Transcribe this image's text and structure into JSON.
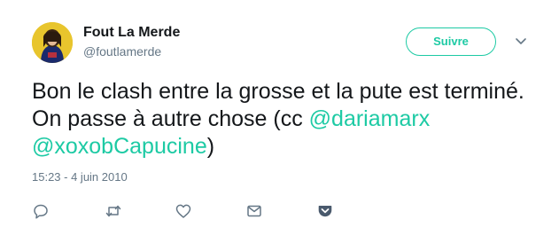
{
  "author": {
    "name": "Fout La Merde",
    "handle": "@foutlamerde"
  },
  "follow_label": "Suivre",
  "tweet": {
    "segments": [
      {
        "text": "Bon le clash entre la grosse et la pute est terminé. On passe à autre chose (cc ",
        "type": "text"
      },
      {
        "text": "@dariamarx",
        "type": "mention"
      },
      {
        "text": " ",
        "type": "text"
      },
      {
        "text": "@xoxobCapucine",
        "type": "mention"
      },
      {
        "text": ")",
        "type": "text"
      }
    ]
  },
  "timestamp": "15:23 - 4 juin 2010",
  "actions": [
    "reply-icon",
    "retweet-icon",
    "like-icon",
    "direct-message-icon",
    "pocket-icon"
  ],
  "colors": {
    "accent": "#1dcaa4",
    "muted": "#657786",
    "text": "#14171a",
    "pocket": "#4a5a6d"
  }
}
